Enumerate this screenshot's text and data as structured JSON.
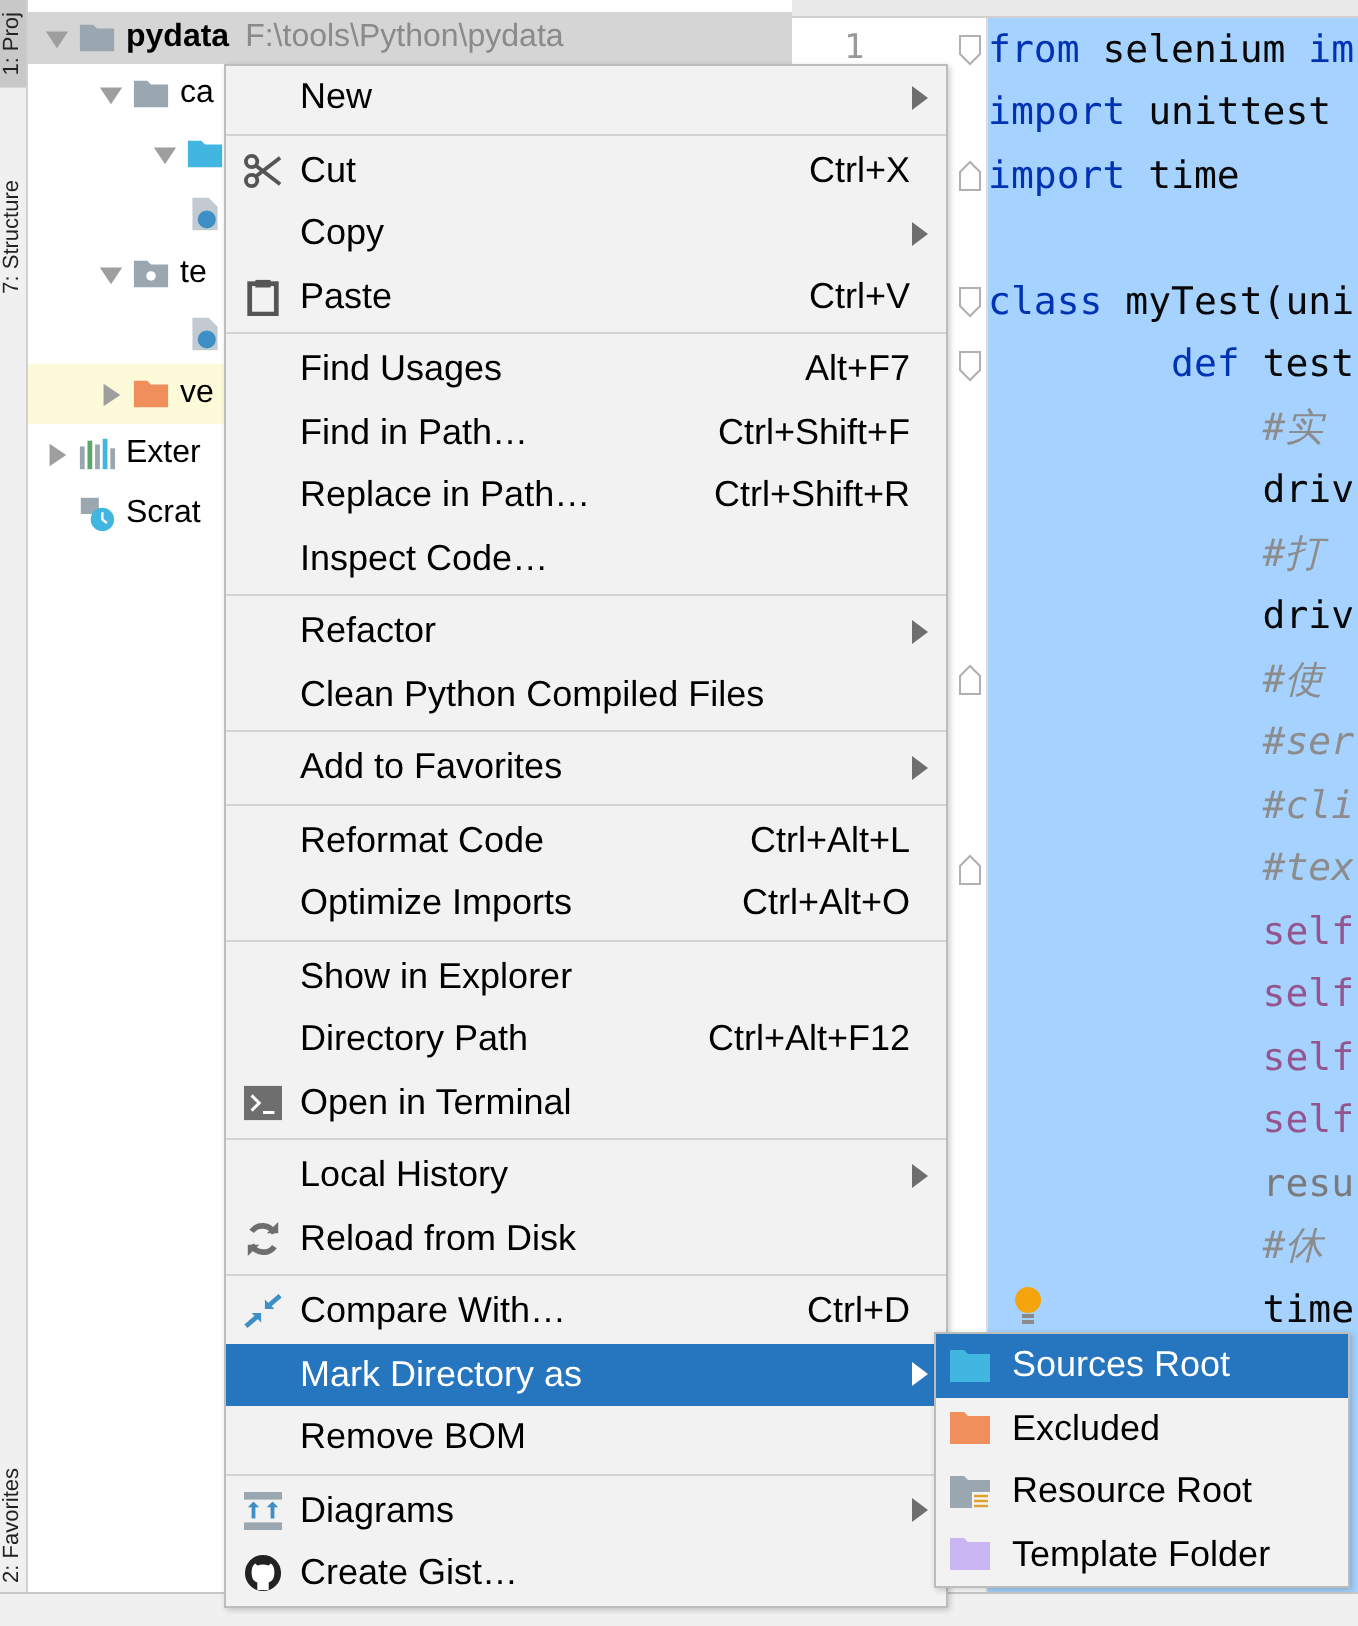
{
  "tool_strip": [
    {
      "label": "1: Proj",
      "selected": true
    },
    {
      "label": "7: Structure",
      "selected": false
    },
    {
      "label": "2: Favorites",
      "selected": false
    }
  ],
  "project_tree": [
    {
      "name": "pydata",
      "path": "F:\\tools\\Python\\pydata",
      "kind": "folder",
      "expanded": true,
      "selected": true,
      "highlighted": false,
      "children": [
        {
          "name": "ca",
          "kind": "folder",
          "expanded": true,
          "selected": false,
          "highlighted": false,
          "children": [
            {
              "kind": "source",
              "expanded": true,
              "selected": false,
              "highlighted": false
            },
            {
              "kind": "python",
              "selected": false,
              "highlighted": false
            }
          ]
        },
        {
          "name": "te",
          "kind": "test",
          "expanded": true,
          "selected": false,
          "highlighted": false,
          "children": [
            {
              "kind": "python",
              "selected": false,
              "highlighted": false
            }
          ]
        },
        {
          "name": "ve",
          "kind": "excluded",
          "expanded": false,
          "selected": false,
          "highlighted": true
        }
      ]
    },
    {
      "name": "Exter",
      "kind": "libraries",
      "expanded": false,
      "selected": false,
      "highlighted": false
    },
    {
      "name": "Scrat",
      "kind": "scratches",
      "selected": false,
      "highlighted": false
    }
  ],
  "editor": {
    "line_numbers": [
      "1"
    ],
    "selection": true,
    "lines": [
      {
        "kind": "top",
        "fold_start": true,
        "tokens": [
          {
            "kind": "keyword",
            "text": "from"
          },
          {
            "kind": "plain",
            "text": " selenium "
          },
          {
            "kind": "keyword",
            "text": "im"
          }
        ]
      },
      {
        "kind": "top",
        "tokens": [
          {
            "kind": "keyword",
            "text": "import"
          },
          {
            "kind": "plain",
            "text": " unittest"
          }
        ]
      },
      {
        "kind": "top",
        "fold_end": true,
        "tokens": [
          {
            "kind": "keyword",
            "text": "import"
          },
          {
            "kind": "plain",
            "text": " time"
          }
        ]
      },
      {
        "kind": "blank"
      },
      {
        "kind": "top",
        "fold_start": true,
        "tokens": [
          {
            "kind": "keyword",
            "text": "class"
          },
          {
            "kind": "plain",
            "text": " myTest(uni"
          }
        ]
      },
      {
        "kind": "member",
        "fold_start": true,
        "tokens": [
          {
            "kind": "keyword",
            "text": "def"
          },
          {
            "kind": "plain",
            "text": " test"
          }
        ]
      },
      {
        "kind": "body",
        "tokens": [
          {
            "kind": "comment",
            "text": "#实"
          }
        ]
      },
      {
        "kind": "body",
        "tokens": [
          {
            "kind": "plain",
            "text": "driv"
          }
        ]
      },
      {
        "kind": "body",
        "tokens": [
          {
            "kind": "comment",
            "text": "#打"
          }
        ]
      },
      {
        "kind": "body",
        "tokens": [
          {
            "kind": "plain",
            "text": "driv"
          }
        ]
      },
      {
        "kind": "body",
        "fold_end": true,
        "tokens": [
          {
            "kind": "comment",
            "text": "#使"
          }
        ]
      },
      {
        "kind": "body",
        "tokens": [
          {
            "kind": "comment",
            "text": "#ser"
          }
        ]
      },
      {
        "kind": "body",
        "tokens": [
          {
            "kind": "comment",
            "text": "#cli"
          }
        ]
      },
      {
        "kind": "body",
        "fold_end": true,
        "tokens": [
          {
            "kind": "comment",
            "text": "#tex"
          }
        ]
      },
      {
        "kind": "body",
        "tokens": [
          {
            "kind": "self",
            "text": "self"
          }
        ]
      },
      {
        "kind": "body",
        "tokens": [
          {
            "kind": "self",
            "text": "self"
          }
        ]
      },
      {
        "kind": "body",
        "tokens": [
          {
            "kind": "self",
            "text": "self"
          }
        ]
      },
      {
        "kind": "body",
        "tokens": [
          {
            "kind": "self",
            "text": "self"
          }
        ]
      },
      {
        "kind": "body",
        "tokens": [
          {
            "kind": "unused",
            "text": "resu"
          }
        ]
      },
      {
        "kind": "body",
        "tokens": [
          {
            "kind": "comment",
            "text": "#休"
          }
        ]
      },
      {
        "kind": "body",
        "bulb": true,
        "tokens": [
          {
            "kind": "plain",
            "text": "time"
          }
        ]
      }
    ]
  },
  "context_menu": [
    [
      {
        "kind": "plain",
        "label": "New",
        "submenu": true,
        "selected": false
      }
    ],
    [
      {
        "kind": "scissors",
        "label": "Cut",
        "shortcut": "Ctrl+X",
        "selected": false
      },
      {
        "kind": "plain",
        "label": "Copy",
        "submenu": true,
        "selected": false
      },
      {
        "kind": "clipboard",
        "label": "Paste",
        "shortcut": "Ctrl+V",
        "selected": false
      }
    ],
    [
      {
        "kind": "plain",
        "label": "Find Usages",
        "shortcut": "Alt+F7",
        "selected": false
      },
      {
        "kind": "plain",
        "label": "Find in Path…",
        "shortcut": "Ctrl+Shift+F",
        "selected": false
      },
      {
        "kind": "plain",
        "label": "Replace in Path…",
        "shortcut": "Ctrl+Shift+R",
        "selected": false
      },
      {
        "kind": "plain",
        "label": "Inspect Code…",
        "selected": false
      }
    ],
    [
      {
        "kind": "plain",
        "label": "Refactor",
        "submenu": true,
        "selected": false
      },
      {
        "kind": "plain",
        "label": "Clean Python Compiled Files",
        "selected": false
      }
    ],
    [
      {
        "kind": "plain",
        "label": "Add to Favorites",
        "submenu": true,
        "selected": false
      }
    ],
    [
      {
        "kind": "plain",
        "label": "Reformat Code",
        "shortcut": "Ctrl+Alt+L",
        "selected": false
      },
      {
        "kind": "plain",
        "label": "Optimize Imports",
        "shortcut": "Ctrl+Alt+O",
        "selected": false
      }
    ],
    [
      {
        "kind": "plain",
        "label": "Show in Explorer",
        "selected": false
      },
      {
        "kind": "plain",
        "label": "Directory Path",
        "shortcut": "Ctrl+Alt+F12",
        "selected": false
      },
      {
        "kind": "terminal",
        "label": "Open in Terminal",
        "selected": false
      }
    ],
    [
      {
        "kind": "plain",
        "label": "Local History",
        "submenu": true,
        "selected": false
      },
      {
        "kind": "reload",
        "label": "Reload from Disk",
        "selected": false
      }
    ],
    [
      {
        "kind": "compare",
        "label": "Compare With…",
        "shortcut": "Ctrl+D",
        "selected": false
      },
      {
        "kind": "plain",
        "label": "Mark Directory as",
        "submenu": true,
        "selected": true
      },
      {
        "kind": "plain",
        "label": "Remove BOM",
        "selected": false
      }
    ],
    [
      {
        "kind": "diagram",
        "label": "Diagrams",
        "submenu": true,
        "selected": false
      },
      {
        "kind": "octocat",
        "label": "Create Gist…",
        "selected": false
      }
    ]
  ],
  "submenu": [
    {
      "kind": "source",
      "label": "Sources Root",
      "selected": true
    },
    {
      "kind": "excluded",
      "label": "Excluded",
      "selected": false
    },
    {
      "kind": "resource",
      "label": "Resource Root",
      "selected": false
    },
    {
      "kind": "template",
      "label": "Template Folder",
      "selected": false
    }
  ]
}
